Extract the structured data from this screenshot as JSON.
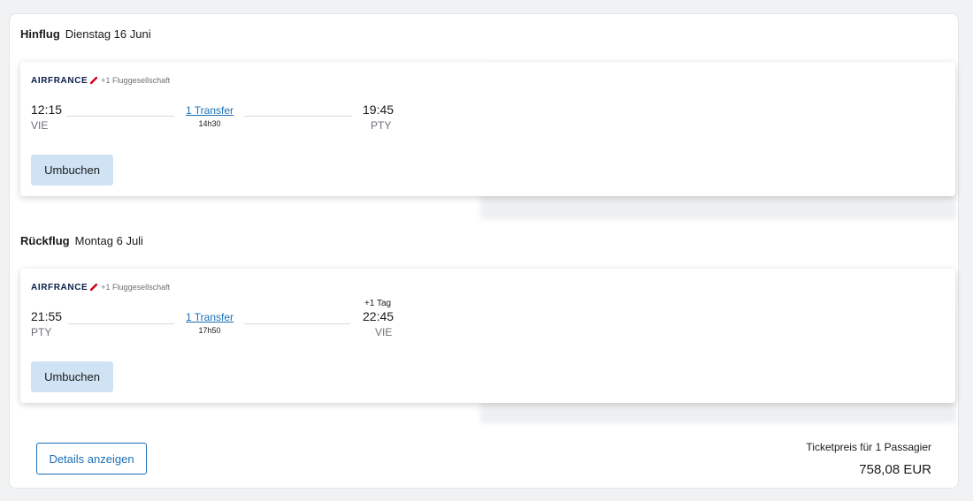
{
  "outbound": {
    "direction": "Hinflug",
    "date": "Dienstag 16 Juni",
    "airline_logo": "AIRFRANCE",
    "extra_airline": "+1 Fluggesellschaft",
    "departure_time": "12:15",
    "departure_code": "VIE",
    "arrival_time": "19:45",
    "arrival_code": "PTY",
    "transfer_label": "1 Transfer",
    "duration": "14h30",
    "rebook_label": "Umbuchen"
  },
  "inbound": {
    "direction": "Rückflug",
    "date": "Montag 6 Juli",
    "airline_logo": "AIRFRANCE",
    "extra_airline": "+1 Fluggesellschaft",
    "departure_time": "21:55",
    "departure_code": "PTY",
    "arrival_time": "22:45",
    "arrival_code": "VIE",
    "arrival_day_offset": "+1 Tag",
    "transfer_label": "1 Transfer",
    "duration": "17h50",
    "rebook_label": "Umbuchen"
  },
  "footer": {
    "details_label": "Details anzeigen",
    "price_label": "Ticketpreis für 1 Passagier",
    "price_value": "758,08 EUR"
  },
  "colors": {
    "accent": "#1c6fb5",
    "button_bg": "#cfe3f5",
    "logo_red": "#d6001c",
    "logo_navy": "#0a1e4a"
  }
}
